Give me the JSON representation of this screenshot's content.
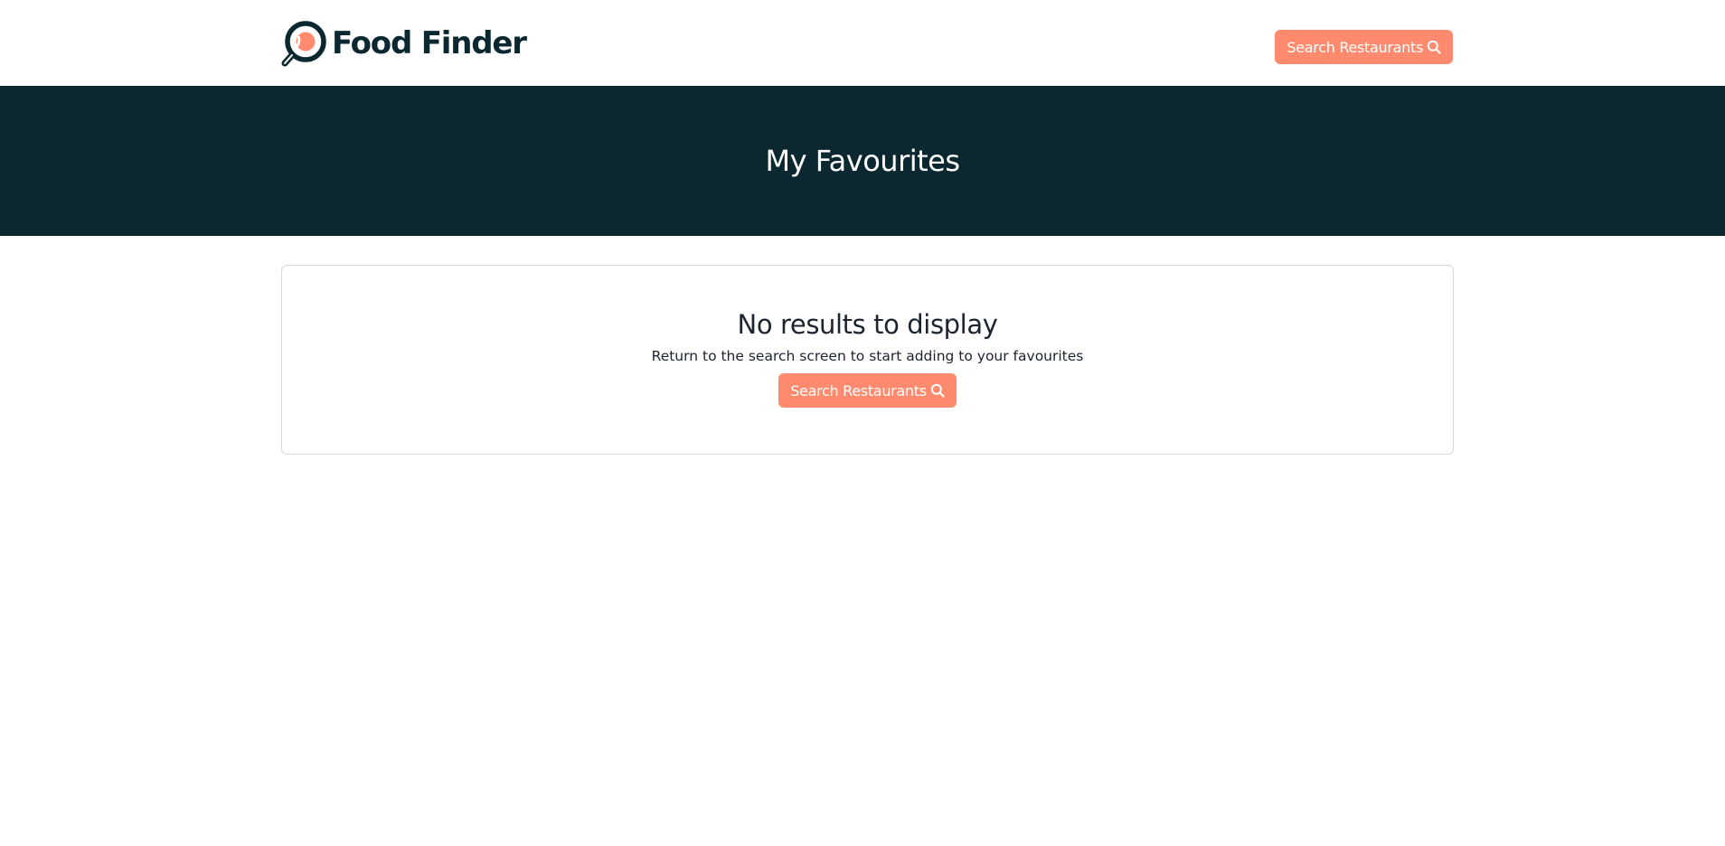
{
  "header": {
    "brand_name": "Food Finder",
    "brand_icon": "magnifier-food-logo",
    "search_button_label": "Search Restaurants",
    "search_button_icon": "search-icon"
  },
  "hero": {
    "title": "My Favourites"
  },
  "empty_state": {
    "title": "No results to display",
    "message": "Return to the search screen to start adding to your favourites",
    "button_label": "Search Restaurants",
    "button_icon": "search-icon"
  },
  "colors": {
    "brand_dark": "#0b2730",
    "accent": "#ff8a6e",
    "background": "#ffffff",
    "card_border": "#d8dadd"
  }
}
